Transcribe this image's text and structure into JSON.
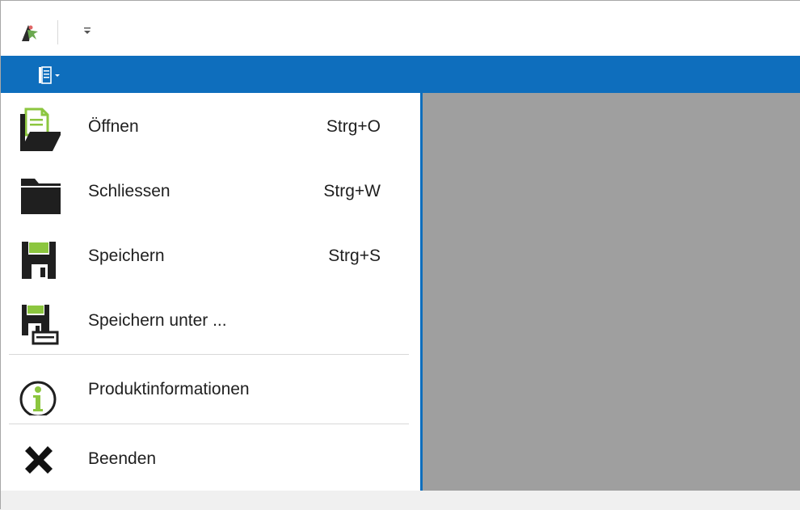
{
  "colors": {
    "ribbon": "#0e6ebd",
    "accent_green": "#8cc63f",
    "content_bg": "#9f9f9f",
    "icon_dark": "#1f1f1f"
  },
  "toolbar": {
    "app_icon": "app-icon",
    "customize_icon": "customize-quick-access-icon"
  },
  "ribbon": {
    "file_icon": "file-menu-icon"
  },
  "menu": {
    "items": [
      {
        "label": "Öffnen",
        "shortcut": "Strg+O",
        "icon": "open-folder-icon"
      },
      {
        "label": "Schliessen",
        "shortcut": "Strg+W",
        "icon": "closed-folder-icon"
      },
      {
        "label": "Speichern",
        "shortcut": "Strg+S",
        "icon": "save-icon"
      },
      {
        "label": "Speichern unter ...",
        "shortcut": "",
        "icon": "save-as-icon"
      },
      {
        "label": "Produktinformationen",
        "shortcut": "",
        "icon": "info-icon"
      },
      {
        "label": "Beenden",
        "shortcut": "",
        "icon": "exit-icon"
      }
    ]
  }
}
